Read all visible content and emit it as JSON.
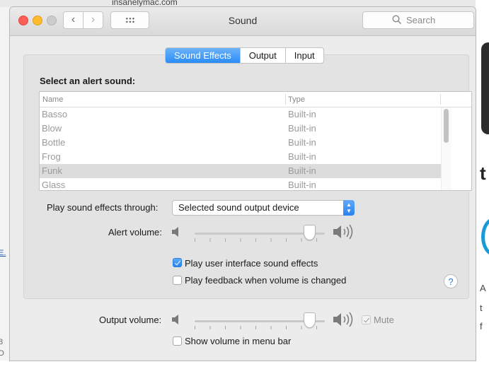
{
  "browser": {
    "url_fragment": "insanelymac.com"
  },
  "window": {
    "title": "Sound"
  },
  "toolbar": {
    "search_placeholder": "Search"
  },
  "tabs": [
    {
      "label": "Sound Effects",
      "active": true
    },
    {
      "label": "Output",
      "active": false
    },
    {
      "label": "Input",
      "active": false
    }
  ],
  "alerts": {
    "heading": "Select an alert sound:",
    "columns": {
      "name": "Name",
      "type": "Type"
    },
    "rows": [
      {
        "name": "Basso",
        "type": "Built-in"
      },
      {
        "name": "Blow",
        "type": "Built-in"
      },
      {
        "name": "Bottle",
        "type": "Built-in"
      },
      {
        "name": "Frog",
        "type": "Built-in"
      },
      {
        "name": "Funk",
        "type": "Built-in",
        "selected": true
      },
      {
        "name": "Glass",
        "type": "Built-in"
      }
    ]
  },
  "effects": {
    "through_label": "Play sound effects through:",
    "through_value": "Selected sound output device",
    "alert_volume_label": "Alert volume:",
    "alert_volume_level": 0.92,
    "ui_sounds_label": "Play user interface sound effects",
    "ui_sounds_checked": true,
    "feedback_label": "Play feedback when volume is changed",
    "feedback_checked": false,
    "help_label": "?"
  },
  "output": {
    "volume_label": "Output volume:",
    "volume_level": 0.92,
    "mute_label": "Mute",
    "mute_checked": true,
    "menu_bar_label": "Show volume in menu bar",
    "menu_bar_checked": false
  },
  "colors": {
    "accent": "#2a8cf6",
    "close": "#fc5f57",
    "minimize": "#fdbc2e"
  }
}
